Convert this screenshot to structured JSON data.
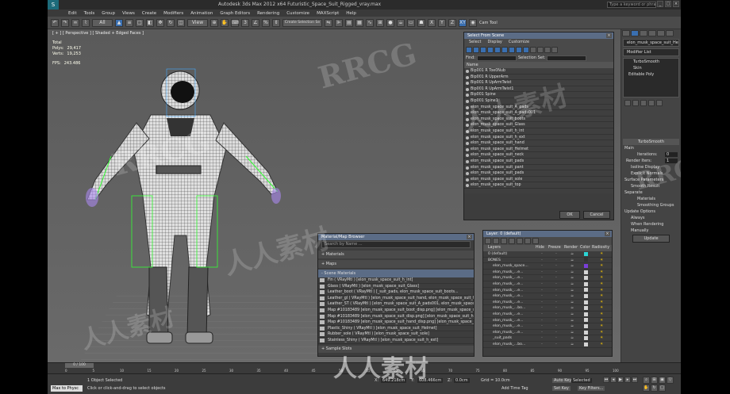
{
  "app": {
    "title": "Autodesk 3ds Max  2012 x64     Futuristic_Space_Suit_Rigged_vray.max",
    "search_placeholder": "Type a keyword or phrase",
    "menus": [
      "Edit",
      "Tools",
      "Group",
      "Views",
      "Create",
      "Modifiers",
      "Animation",
      "Graph Editors",
      "Rendering",
      "Customize",
      "MAXScript",
      "Help"
    ],
    "toolbar": {
      "selection_filter": "All",
      "view_dropdown": "View",
      "create_sel_set": "Create Selection Se",
      "cam_tool": "Cam Tool"
    }
  },
  "viewport": {
    "label": "[ + ] [ Perspective ] [ Shaded + Edged Faces ]",
    "stats": [
      {
        "k": "Total",
        "v": ""
      },
      {
        "k": "Polys:",
        "v": "29,417"
      },
      {
        "k": "Verts:",
        "v": "19,253"
      },
      {
        "k": "FPS:",
        "v": "243.486"
      }
    ]
  },
  "select_from_scene": {
    "title": "Select From Scene",
    "menus": [
      "Select",
      "Display",
      "Customize"
    ],
    "find_label": "Find:",
    "selection_set_label": "Selection Set:",
    "name_header": "Name",
    "items": [
      "Bip001 R Toe0Nub",
      "Bip001 R UpperArm",
      "Bip001 R UpArmTwist",
      "Bip001 R UpArmTwist1",
      "Bip001 Spine",
      "Bip001 Spine1",
      "elon_musk_space_suit_A_pads",
      "elon_musk_space_suit_A_pads001",
      "elon_musk_space_suit_boots",
      "elon_musk_space_suit_Glass",
      "elon_musk_space_suit_h_int",
      "elon_musk_space_suit_h_ext",
      "elon_musk_space_suit_hand",
      "elon_musk_space_suit_Helmet",
      "elon_musk_space_suit_neck",
      "elon_musk_space_suit_pads",
      "elon_musk_space_suit_pant",
      "elon_musk_space_suit_pads",
      "elon_musk_space_suit_sole",
      "elon_musk_space_suit_top"
    ],
    "ok": "OK",
    "cancel": "Cancel"
  },
  "material_browser": {
    "title": "Material/Map Browser",
    "search_placeholder": "Search by Name ...",
    "groups": [
      "+ Materials",
      "+ Maps",
      "- Scene Materials"
    ],
    "items": [
      "Fin ( VRayMtl ) [elon_musk_space_suit_h_int]",
      "Glass ( VRayMtl ) [elon_musk_space_suit_Glass]",
      "Leather_boot ( VRayMtl ) [_suit_pads, elon_musk_space_suit_boots...",
      "Leather_gl ( VRayMtl ) [elon_musk_space_suit_hand, elon_musk_space_suit_h...",
      "Leather_ST ( VRayMtl ) [elon_musk_space_suit_A_pads001, elon_musk_space_s...",
      "Map #10183489 [elon_musk_space_suit_boot_disp.png] [elon_musk_space_suit...",
      "Map #10183489 [elon_musk_space_suit_disp.png] [elon_musk_space_suit_h_ext...",
      "Map #10183489 [elon_musk_space_suit_hand_disp.png] [elon_musk_space_suit_hand]",
      "Plastic_Shiny ( VRayMtl ) [elon_musk_space_suit_Helmet]",
      "Rubber_sole ( VRayMtl ) [elon_musk_space_suit_sole]",
      "Stainless_Shiny ( VRayMtl ) [elon_musk_space_suit_h_ext]"
    ],
    "footer": "+ Sample Slots"
  },
  "layer_manager": {
    "title": "Layer: 0 (default)",
    "columns": [
      "Layers",
      "Hide",
      "Freeze",
      "Render",
      "Color",
      "Radiosity"
    ],
    "layers": [
      "0 (default)",
      "BONES",
      "elon_musk_space...",
      "elon_musk_...e...",
      "elon_musk_...e...",
      "elon_musk_...e...",
      "elon_musk_...e...",
      "elon_musk_...e...",
      "elon_musk_...e...",
      "elon_musk_...bo...",
      "elon_musk_...e...",
      "elon_musk_...e...",
      "elon_musk_...e...",
      "elon_musk_...e...",
      "_suit_pads",
      "elon_musk_...bo..."
    ],
    "colors": [
      "#2bd4d4",
      "#333333",
      "#7a3ed9",
      "#d4d4d4",
      "#d4d4d4",
      "#d4d4d4",
      "#d4d4d4",
      "#d4d4d4",
      "#d4d4d4",
      "#d4d4d4",
      "#d4d4d4",
      "#d4d4d4",
      "#d4d4d4",
      "#d4d4d4",
      "#d4d4d4",
      "#d4d4d4"
    ]
  },
  "command_panel": {
    "object_name": "elon_musk_space_suit_Helme",
    "modifier_list": "Modifier List",
    "stack": [
      "TurboSmooth",
      "Skin",
      "Editable Poly"
    ],
    "rollout_title": "TurboSmooth",
    "main_label": "Main",
    "iterations_label": "Iterations:",
    "iterations_value": "0",
    "render_iters_label": "Render Iters:",
    "render_iters_value": "1",
    "isoline": "Isoline Display",
    "explicit": "Explicit Normals",
    "surface_params": "Surface Parameters",
    "smooth_result": "Smooth Result",
    "separate": "Separate",
    "materials": "Materials",
    "smoothing_groups": "Smoothing Groups",
    "update_options": "Update Options",
    "always": "Always",
    "when_rendering": "When Rendering",
    "manually": "Manually",
    "update_btn": "Update"
  },
  "timeline": {
    "frame": "0 / 100",
    "ticks": [
      "0",
      "5",
      "10",
      "15",
      "20",
      "25",
      "30",
      "35",
      "40",
      "45",
      "50",
      "55",
      "60",
      "65",
      "70",
      "75",
      "80",
      "85",
      "90",
      "95",
      "100"
    ]
  },
  "status": {
    "maxscript": "Max to Physc",
    "selected": "1 Object Selected",
    "prompt": "Click or click-and-drag to select objects",
    "x_label": "X:",
    "x": "649.218cm",
    "y_label": "Y:",
    "y": "608.466cm",
    "z_label": "Z:",
    "z": "0.0cm",
    "grid": "Grid = 10.0cm",
    "auto_key": "Auto Key",
    "selected_dd": "Selected",
    "set_key": "Set Key",
    "key_filters": "Key Filters...",
    "add_time_tag": "Add Time Tag"
  },
  "watermarks": [
    "RRCG",
    "人人素材",
    "RRCG",
    "人人素材",
    "RRCG",
    "人人素材",
    "人人素材"
  ]
}
